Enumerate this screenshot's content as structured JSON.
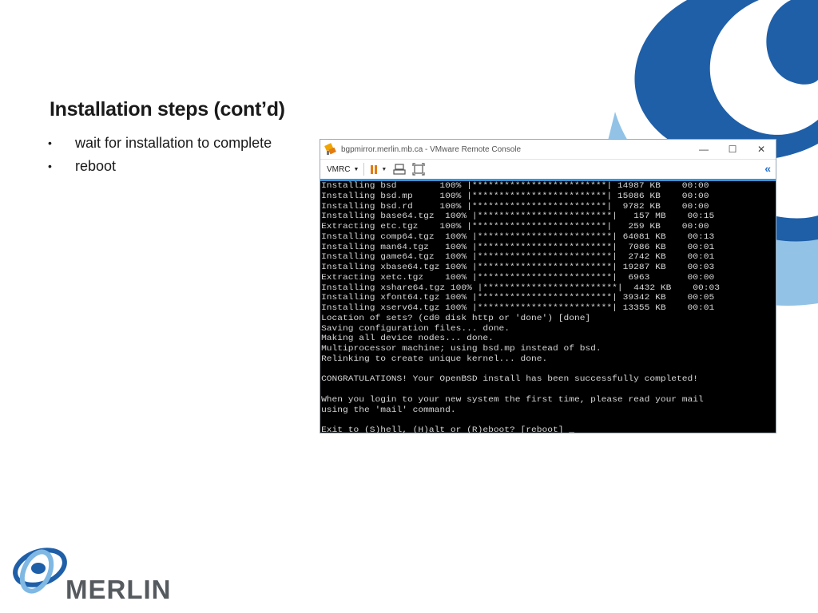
{
  "slide": {
    "title": "Installation steps (cont’d)",
    "bullets": [
      {
        "marker": "•",
        "text": "wait for installation to complete"
      },
      {
        "marker": "•",
        "text": "reboot"
      }
    ]
  },
  "vmrc_window": {
    "title": "bgpmirror.merlin.mb.ca - VMware Remote Console",
    "controls": {
      "minimize": "—",
      "maximize": "☐",
      "close": "✕"
    },
    "toolbar": {
      "vmrc_menu_label": "VMRC",
      "menu_caret": "▼",
      "collapse_glyph": "«",
      "icons": [
        "pause-icon",
        "send-keys-icon",
        "fullscreen-icon"
      ]
    },
    "console_lines": [
      "Installing bsd        100% |*************************| 14987 KB    00:00",
      "Installing bsd.mp     100% |*************************| 15086 KB    00:00",
      "Installing bsd.rd     100% |*************************|  9782 KB    00:00",
      "Installing base64.tgz  100% |*************************|   157 MB    00:15",
      "Extracting etc.tgz    100% |*************************|   259 KB    00:00",
      "Installing comp64.tgz  100% |*************************| 64081 KB    00:13",
      "Installing man64.tgz   100% |*************************|  7086 KB    00:01",
      "Installing game64.tgz  100% |*************************|  2742 KB    00:01",
      "Installing xbase64.tgz 100% |*************************| 19287 KB    00:03",
      "Extracting xetc.tgz    100% |*************************|  6963       00:00",
      "Installing xshare64.tgz 100% |*************************|  4432 KB    00:03",
      "Installing xfont64.tgz 100% |*************************| 39342 KB    00:05",
      "Installing xserv64.tgz 100% |*************************| 13355 KB    00:01",
      "Location of sets? (cd0 disk http or 'done') [done]",
      "Saving configuration files... done.",
      "Making all device nodes... done.",
      "Multiprocessor machine; using bsd.mp instead of bsd.",
      "Relinking to create unique kernel... done.",
      "",
      "CONGRATULATIONS! Your OpenBSD install has been successfully completed!",
      "",
      "When you login to your new system the first time, please read your mail",
      "using the 'mail' command.",
      "",
      "Exit to (S)hell, (H)alt or (R)eboot? [reboot] _"
    ]
  },
  "logo": {
    "text": "MERLIN"
  },
  "colors": {
    "accent_blue": "#1f6fb4",
    "light_blue": "#7fb8e3",
    "pause_orange": "#e27b12",
    "toolbar_border": "#3a94d8"
  }
}
